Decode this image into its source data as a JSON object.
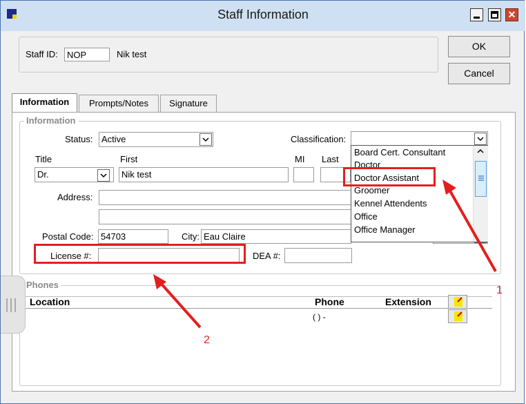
{
  "window": {
    "title": "Staff Information"
  },
  "header": {
    "staff_id_label": "Staff ID:",
    "staff_id_value": "NOP",
    "staff_name": "Nik test"
  },
  "buttons": {
    "ok": "OK",
    "cancel": "Cancel"
  },
  "tabs": [
    {
      "label": "Information"
    },
    {
      "label": "Prompts/Notes"
    },
    {
      "label": "Signature"
    }
  ],
  "info": {
    "section_label": "Information",
    "status_label": "Status:",
    "status_value": "Active",
    "classification_label": "Classification:",
    "title_label": "Title",
    "title_value": "Dr.",
    "first_label": "First",
    "first_value": "Nik test",
    "mi_label": "MI",
    "last_label": "Last",
    "address_label": "Address:",
    "postal_label": "Postal Code:",
    "postal_value": "54703",
    "city_label": "City:",
    "city_value": "Eau Claire",
    "license_label": "License #:",
    "dea_label": "DEA #:"
  },
  "classification_options": [
    "Board Cert. Consultant",
    "Doctor",
    "Doctor Assistant",
    "Groomer",
    "Kennel Attendents",
    "Office",
    "Office Manager"
  ],
  "phones": {
    "section_label": "Phones",
    "columns": {
      "location": "Location",
      "phone": "Phone",
      "extension": "Extension"
    },
    "row_phone": "(   )   -"
  },
  "annotations": {
    "callout_1": "1",
    "callout_2": "2"
  },
  "colors": {
    "highlight": "#e41e1e",
    "titlebar": "#cfe0f2"
  },
  "icons": {
    "minimize": "minimize-icon",
    "maximize": "maximize-icon",
    "close": "close-icon",
    "app": "app-icon",
    "notepad": "notepad-icon"
  }
}
